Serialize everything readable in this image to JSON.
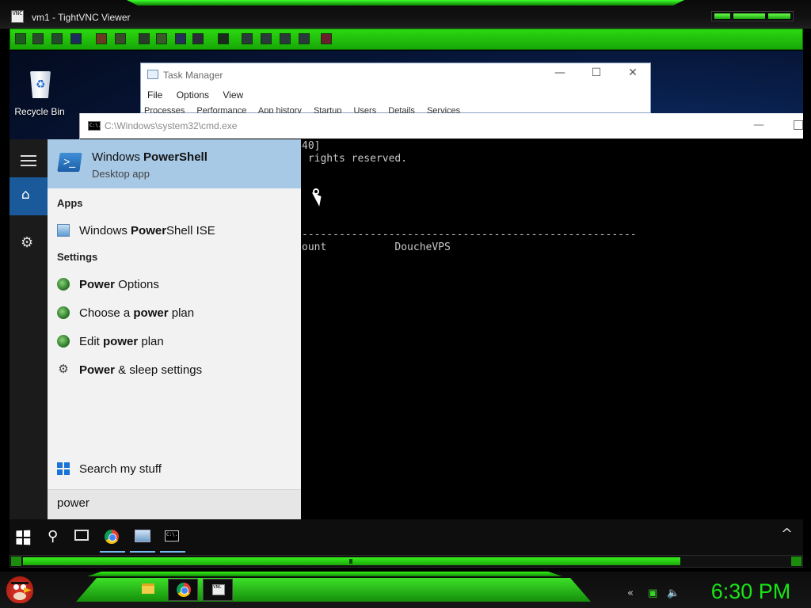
{
  "vnc": {
    "title": "vm1 - TightVNC Viewer",
    "icon_text": "VNC"
  },
  "desktop": {
    "recycle_bin_label": "Recycle Bin"
  },
  "task_manager": {
    "title": "Task Manager",
    "menu": [
      "File",
      "Options",
      "View"
    ],
    "tabs": [
      "Processes",
      "Performance",
      "App history",
      "Startup",
      "Users",
      "Details",
      "Services"
    ]
  },
  "cmd": {
    "title": "C:\\Windows\\system32\\cmd.exe",
    "icon_text": "C:\\.",
    "lines": [
      "40]",
      " rights reserved.",
      "------------------------------------------------------",
      "ount           DoucheVPS"
    ]
  },
  "start_menu": {
    "best_match": {
      "title_plain": "Windows ",
      "title_bold": "PowerShell",
      "subtitle": "Desktop app"
    },
    "apps_header": "Apps",
    "apps": [
      {
        "pre": "Windows ",
        "bold": "Power",
        "post": "Shell ISE",
        "icon": "powershell-ise-icon"
      }
    ],
    "settings_header": "Settings",
    "settings": [
      {
        "pre": "",
        "bold": "Power",
        "post": " Options",
        "icon": "power-options-icon"
      },
      {
        "pre": "Choose a ",
        "bold": "power",
        "post": " plan",
        "icon": "power-options-icon"
      },
      {
        "pre": "Edit ",
        "bold": "power",
        "post": " plan",
        "icon": "power-options-icon"
      },
      {
        "pre": "",
        "bold": "Power",
        "post": " & sleep settings",
        "icon": "gear-icon"
      }
    ],
    "search_my_stuff": "Search my stuff",
    "search_value": "power"
  },
  "host_clock": "6:30 PM",
  "colors": {
    "accent_green": "#19e517",
    "start_highlight": "#a7c9e6",
    "start_home": "#1a5a9a"
  }
}
